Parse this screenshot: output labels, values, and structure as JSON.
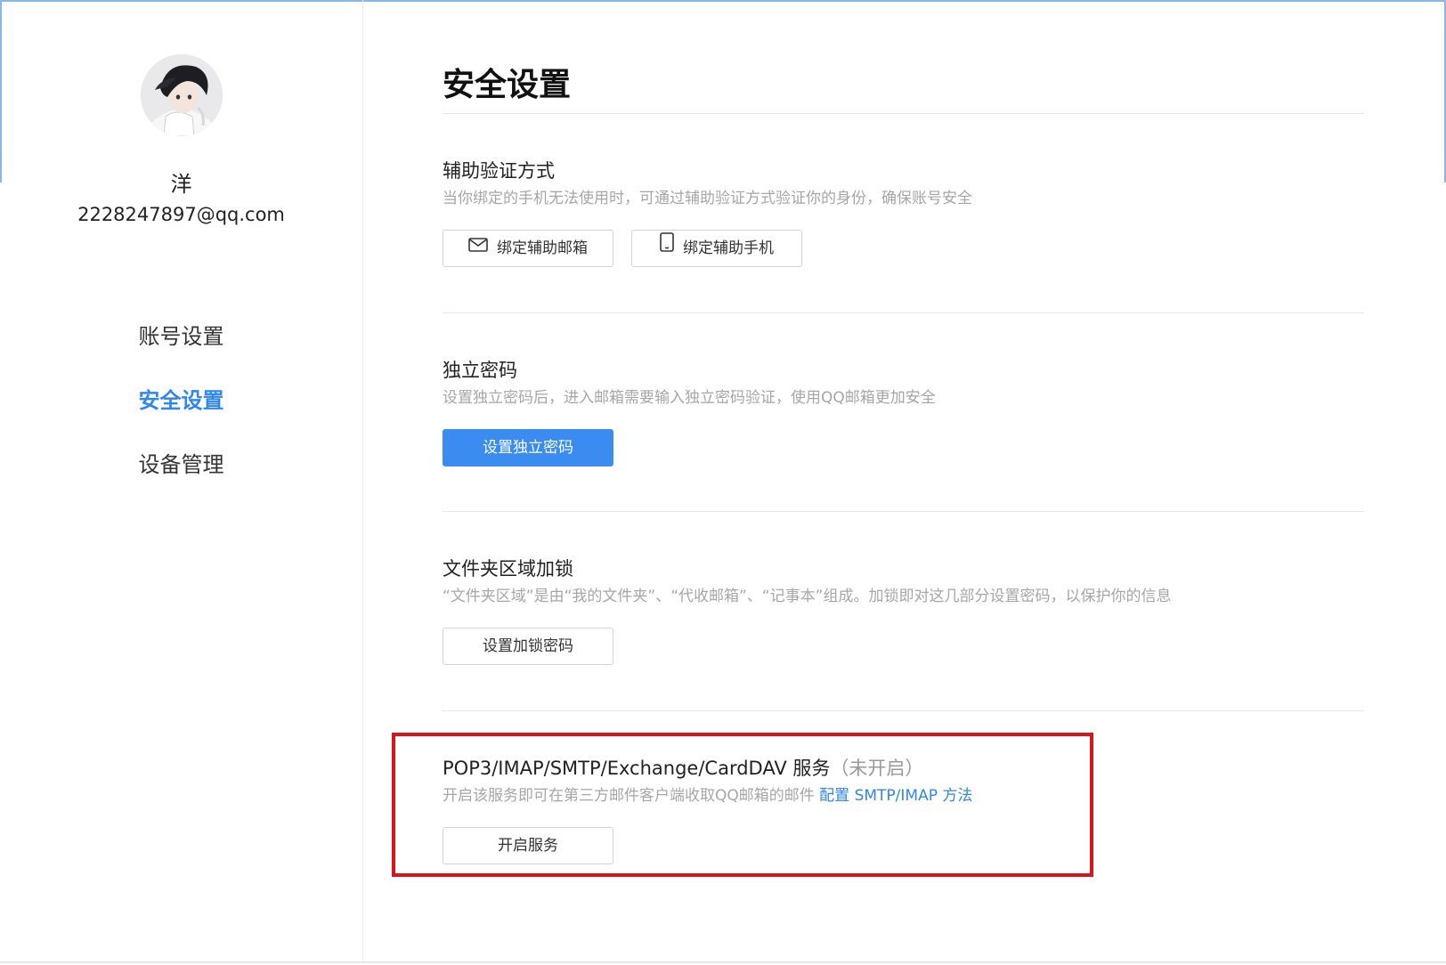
{
  "sidebar": {
    "avatar_icon": "user-avatar",
    "user_name": "洋",
    "user_email": "2228247897@qq.com",
    "nav": [
      {
        "label": "账号设置",
        "active": false
      },
      {
        "label": "安全设置",
        "active": true
      },
      {
        "label": "设备管理",
        "active": false
      }
    ]
  },
  "main": {
    "title": "安全设置",
    "sections": [
      {
        "title": "辅助验证方式",
        "desc": "当你绑定的手机无法使用时，可通过辅助验证方式验证你的身份，确保账号安全",
        "buttons": [
          {
            "label": "绑定辅助邮箱",
            "icon": "mail-icon"
          },
          {
            "label": "绑定辅助手机",
            "icon": "phone-icon"
          }
        ]
      },
      {
        "title": "独立密码",
        "desc": "设置独立密码后，进入邮箱需要输入独立密码验证，使用QQ邮箱更加安全",
        "buttons": [
          {
            "label": "设置独立密码",
            "primary": true
          }
        ]
      },
      {
        "title": "文件夹区域加锁",
        "desc": "“文件夹区域”是由“我的文件夹”、“代收邮箱”、“记事本”组成。加锁即对这几部分设置密码，以保护你的信息",
        "buttons": [
          {
            "label": "设置加锁密码"
          }
        ]
      },
      {
        "title": "POP3/IMAP/SMTP/Exchange/CardDAV 服务",
        "status": "（未开启）",
        "desc": "开启该服务即可在第三方邮件客户端收取QQ邮箱的邮件",
        "link": "配置 SMTP/IMAP 方法",
        "buttons": [
          {
            "label": "开启服务"
          }
        ]
      }
    ]
  },
  "colors": {
    "accent": "#2f86f0",
    "primary_button": "#3b8cf1",
    "highlight": "#d9141b"
  }
}
